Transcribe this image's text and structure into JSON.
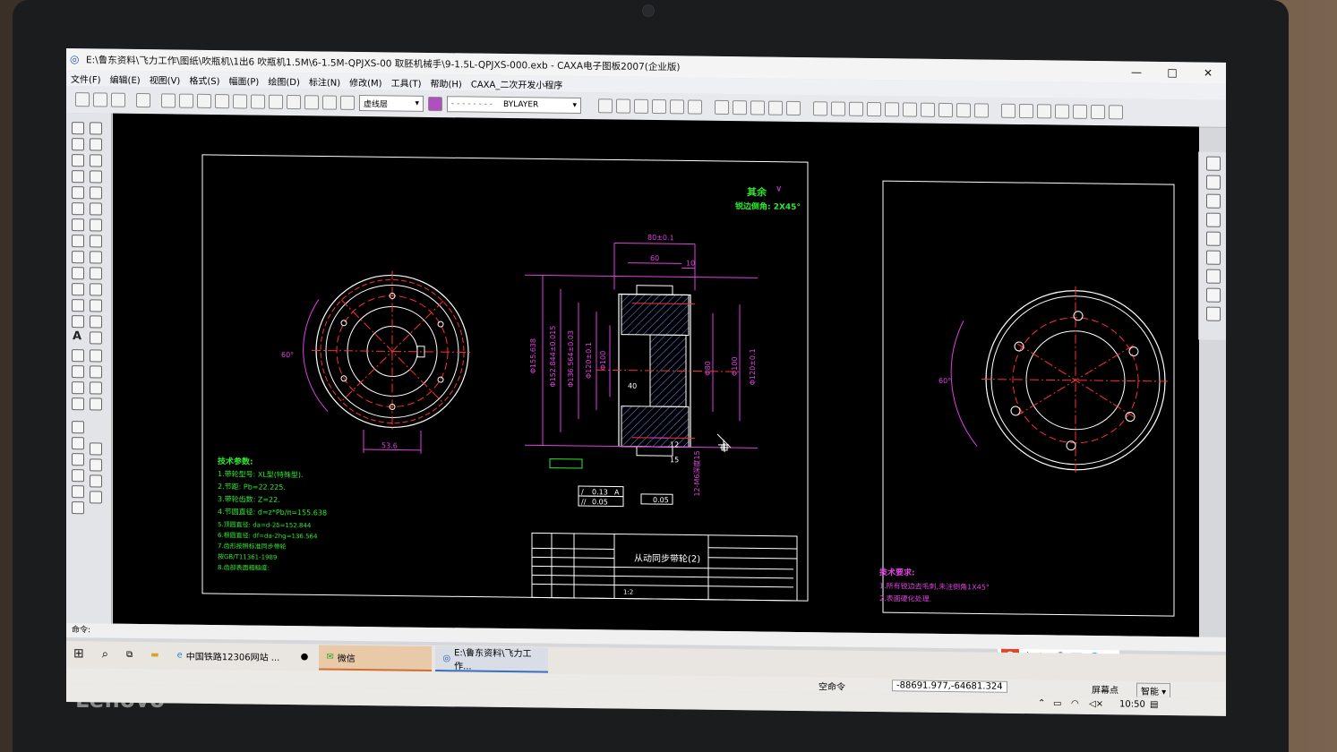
{
  "window": {
    "title": "E:\\鲁东资料\\飞力工作\\图纸\\吹瓶机\\1出6 吹瓶机1.5M\\6-1.5M-QPJXS-00 取胚机械手\\9-1.5L-QPJXS-000.exb - CAXA电子图板2007(企业版)",
    "minimize": "—",
    "maximize": "□",
    "close": "✕"
  },
  "menu": [
    "文件(F)",
    "编辑(E)",
    "视图(V)",
    "格式(S)",
    "幅面(P)",
    "绘图(D)",
    "标注(N)",
    "修改(M)",
    "工具(T)",
    "帮助(H)",
    "CAXA_二次开发小程序"
  ],
  "toolbar": {
    "layer_label": "虚线层",
    "linetype_label": "BYLAYER"
  },
  "drawing": {
    "note_top_right": "其余",
    "note_chamfer": "锐边倒角: 2X45°",
    "part_name": "从动同步带轮(2)",
    "tech_params_title": "技术参数:",
    "tech_params": [
      "1.带轮型号: XL型(特殊型).",
      "2.节距:       Pb=22.225.",
      "3.带轮齿数: Z=22.",
      "4.节圆直径: d=z*Pb/π=155.638",
      "5.顶圆直径: da=d-2δ=152.844",
      "6.根圆直径: df=da-2hg=136.564",
      "7.齿形按照标准同步带轮",
      "  按GB/T11361-1989",
      "8.齿部表面粗糙度:"
    ],
    "tech_req_title": "技术要求:",
    "tech_req": [
      "1.所有锐边去毛刺,未注倒角1X45°",
      "2.表面硬化处理."
    ],
    "dims": {
      "d1": "80±0.1",
      "d2": "60",
      "d3": "10",
      "d4": "40",
      "d5": "12",
      "d6": "15",
      "d7": "Φ155.638",
      "d8": "Φ152.844±0.015",
      "d9": "Φ136.564±0.03",
      "d10": "Φ120±0.1",
      "d11": "Φ100",
      "d12": "Φ80",
      "d13": "Φ100",
      "d14": "Φ120±0.1",
      "d15": "53.6",
      "d16": "60°",
      "d17": "60°",
      "d18": "12-M6深度15",
      "tol1": "0.13",
      "tol2": "0.05",
      "tol3": "0.05",
      "tolA": "A",
      "scale": "1:2"
    }
  },
  "command": {
    "prompt": "命令:",
    "status": "空命令",
    "coords": "-88691.977,-64681.324",
    "snap": "屏幕点",
    "mode": "智能"
  },
  "taskbar": {
    "item1": "中国铁路12306网站 ...",
    "item2": "微信",
    "item3": "E:\\鲁东资料\\飞力工作..."
  },
  "ime": {
    "logo": "S",
    "lang": "中"
  },
  "tray": {
    "time": "10:50"
  },
  "brand": "Lenovo",
  "colors": {
    "dim": "#e040e0",
    "text": "#2ee82e",
    "center": "#ff3030",
    "outline": "#ffffff"
  }
}
